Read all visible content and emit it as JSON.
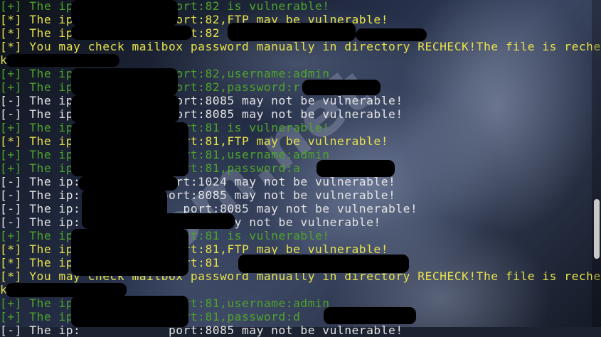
{
  "watermark": "com.net",
  "terminal": {
    "lines": [
      "[+] The ip:            port:82 is vulnerable!",
      "[*] The ip:            port:82,FTP may be vulnerable!",
      "[*] The ip:            port:82",
      "[*] You may check mailbox password manually in directory RECHECK!The file is rechec",
      "k",
      "[+] The ip:            port:82,username:admin",
      "[+] The ip:            port:82,password:r",
      "[-] The ip:            port:8085 may not be vulnerable!",
      "[-] The ip:            port:8085 may not be vulnerable!",
      "[+] The ip:            port:81 is vulnerable!",
      "[*] The ip:            port:81,FTP may be vulnerable!",
      "[+] The ip:            port:81,username:admin",
      "[+] The ip:            port:81,password:a",
      "[-] The ip:           port:1024 may not be vulnerable!",
      "[-] The ip:           port:8085 may not be vulnerable!",
      "[-] The ip:              port:8085 may not be vulnerable!",
      "[-] The ip:              0000 may not be vulnerable!",
      "[+] The ip:            port:81 is vulnerable!",
      "[*] The ip:            port:81,FTP may be vulnerable!",
      "[*] The ip:            port:81",
      "[*] You may check mailbox password manually in directory RECHECK!The file is rechec",
      "k",
      "[+] The ip:            port:81,username:admin",
      "[+] The ip:            port:81,password:d",
      "[-] The ip:            port:8085 may not be vulnerable!"
    ]
  },
  "colors": {
    "green": "#4ea42a",
    "yellow": "#e8e24a",
    "white": "#e4e4e4",
    "redaction": "#000000"
  }
}
